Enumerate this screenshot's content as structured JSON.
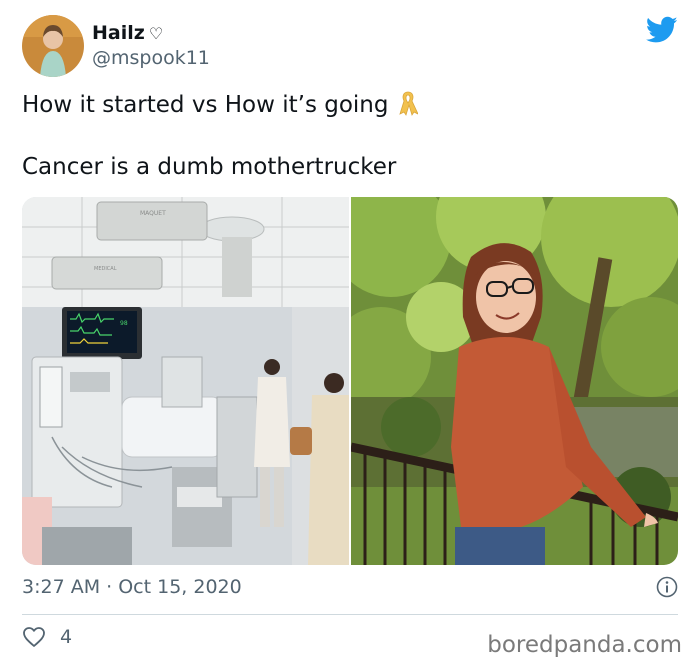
{
  "author": {
    "name": "Hailz",
    "name_symbol": "♡",
    "handle": "@mspook11"
  },
  "tweet": {
    "line1": "How it started vs How it’s going",
    "line2": "Cancer is a dumb mothertrucker",
    "emoji_icon": "gold-ribbon-icon"
  },
  "media_labels": {
    "monitor_brand": "MAQUET",
    "arm_brand": "MEDICAL"
  },
  "meta": {
    "timestamp": "3:27 AM · Oct 15, 2020"
  },
  "engagement": {
    "likes": "4"
  },
  "watermark": "boredpanda.com",
  "colors": {
    "twitter_blue": "#1d9bf0",
    "ribbon_gold": "#f2c14e",
    "secondary_text": "#536471"
  }
}
